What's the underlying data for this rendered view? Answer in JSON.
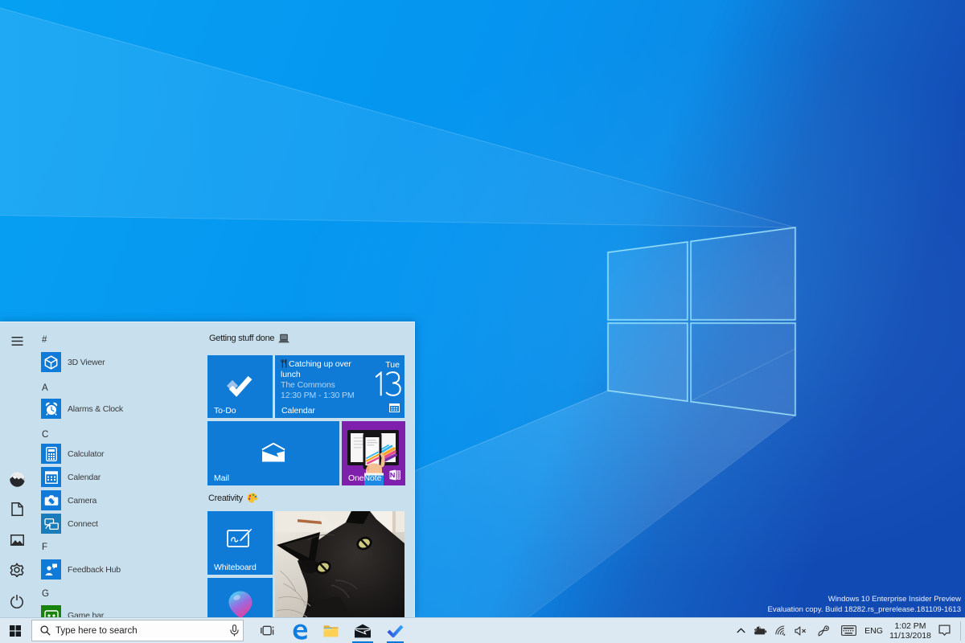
{
  "desktop": {
    "watermark_line1": "Windows 10 Enterprise Insider Preview",
    "watermark_line2": "Evaluation copy. Build 18282.rs_prerelease.181109-1613"
  },
  "start_menu": {
    "app_list": [
      {
        "type": "header",
        "label": "#"
      },
      {
        "type": "app",
        "label": "3D Viewer",
        "icon": "3d-viewer-icon"
      },
      {
        "type": "header",
        "label": "A"
      },
      {
        "type": "app",
        "label": "Alarms & Clock",
        "icon": "alarms-clock-icon"
      },
      {
        "type": "header",
        "label": "C"
      },
      {
        "type": "app",
        "label": "Calculator",
        "icon": "calculator-icon"
      },
      {
        "type": "app",
        "label": "Calendar",
        "icon": "calendar-icon"
      },
      {
        "type": "app",
        "label": "Camera",
        "icon": "camera-icon"
      },
      {
        "type": "app",
        "label": "Connect",
        "icon": "connect-icon"
      },
      {
        "type": "header",
        "label": "F"
      },
      {
        "type": "app",
        "label": "Feedback Hub",
        "icon": "feedback-hub-icon"
      },
      {
        "type": "header",
        "label": "G"
      },
      {
        "type": "app",
        "label": "Game bar",
        "icon": "game-bar-icon"
      }
    ],
    "groups": [
      {
        "title": "Getting stuff done",
        "emoji": "laptop"
      },
      {
        "title": "Creativity",
        "emoji": "palette"
      }
    ],
    "tiles": {
      "todo": {
        "label": "To-Do"
      },
      "calendar": {
        "event_title": "Catching up over lunch",
        "event_location": "The Commons",
        "event_time": "12:30 PM - 1:30 PM",
        "day": "Tue",
        "date": "13",
        "label": "Calendar"
      },
      "mail": {
        "label": "Mail"
      },
      "onenote": {
        "label": "OneNote"
      },
      "whiteboard": {
        "label": "Whiteboard"
      }
    }
  },
  "taskbar": {
    "search": {
      "placeholder": "Type here to search"
    },
    "tray": {
      "language": "ENG",
      "time": "1:02 PM",
      "date": "11/13/2018"
    }
  }
}
